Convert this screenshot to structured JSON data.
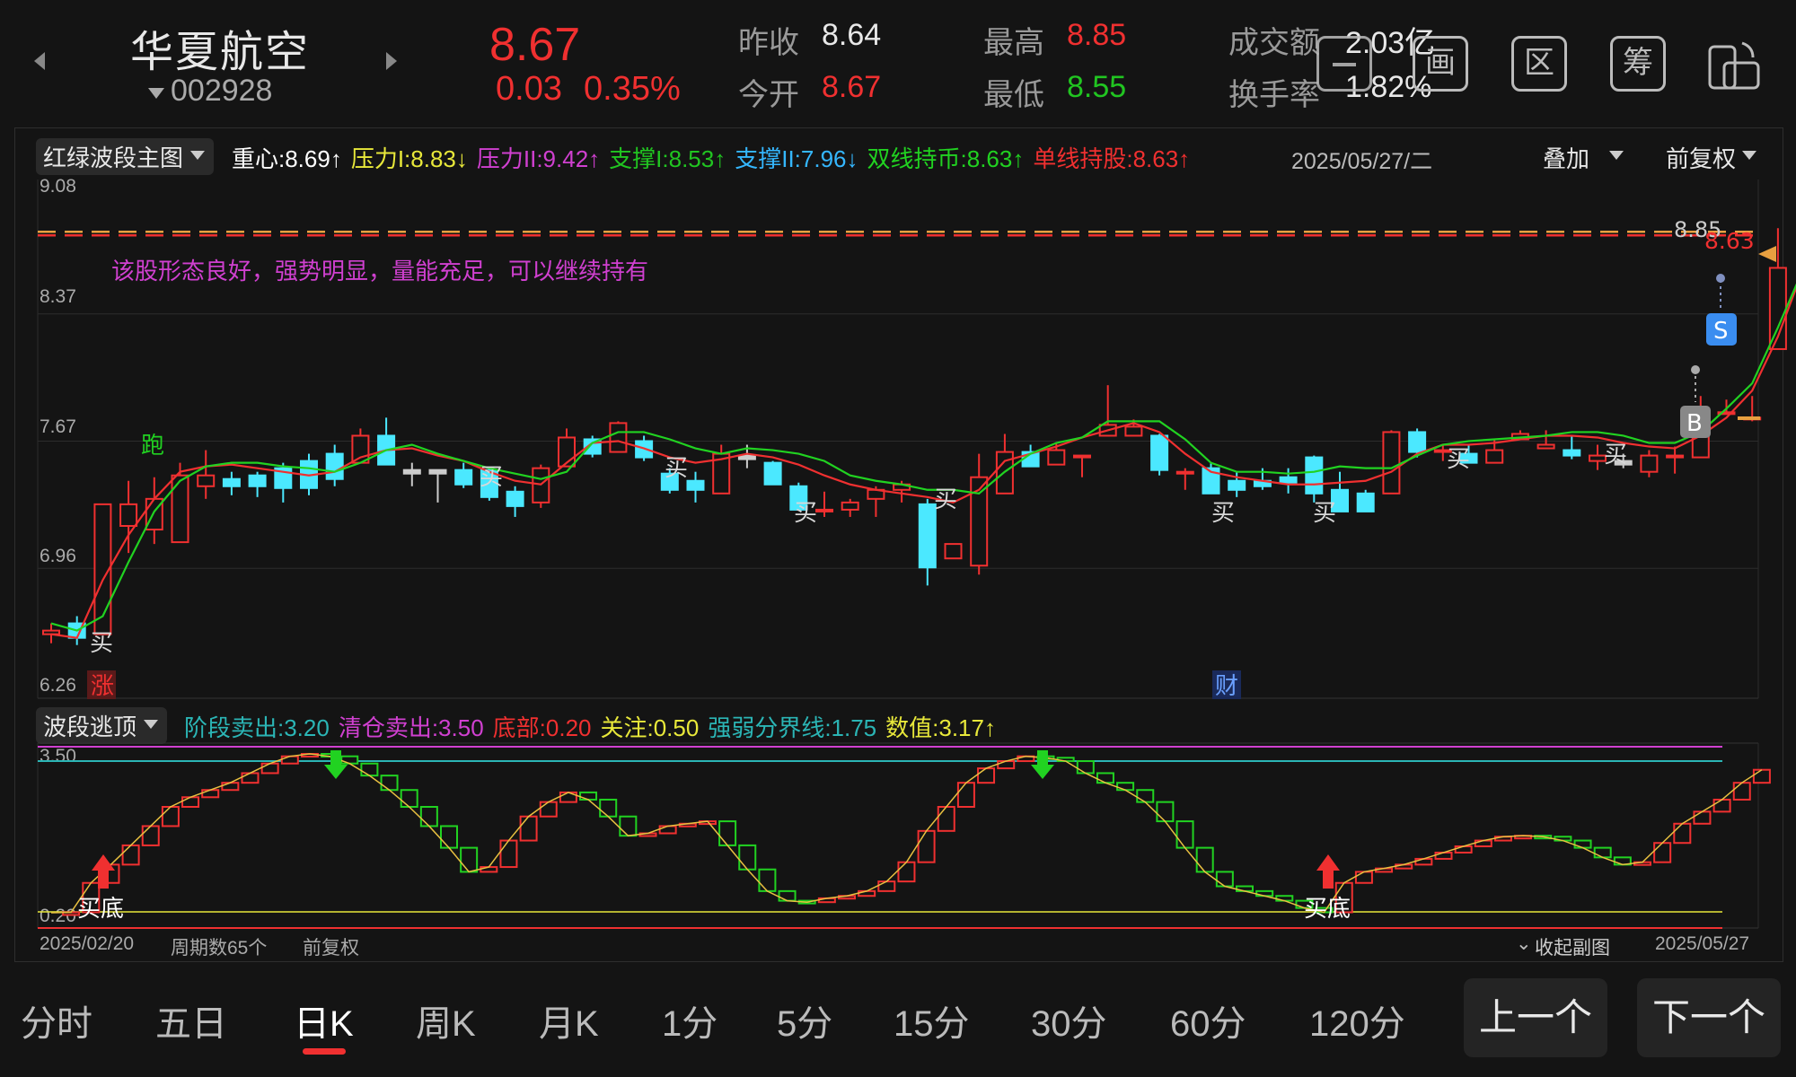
{
  "stock": {
    "name": "华夏航空",
    "code": "002928",
    "price": "8.67",
    "change": "0.03",
    "change_pct": "0.35%"
  },
  "quote": {
    "prev_close_label": "昨收",
    "prev_close": "8.64",
    "open_label": "今开",
    "open": "8.67",
    "high_label": "最高",
    "high": "8.85",
    "low_label": "最低",
    "low": "8.55",
    "turnover_label": "成交额",
    "turnover": "2.03亿",
    "rate_label": "换手率",
    "rate": "1.82%"
  },
  "tools": [
    "画",
    "区",
    "筹"
  ],
  "main_chart": {
    "selector": "红绿波段主图",
    "indicators": [
      {
        "text": "重心:8.69↑",
        "color": "#ffffff"
      },
      {
        "text": "压力I:8.83↓",
        "color": "#e8e83a"
      },
      {
        "text": "压力II:9.42↑",
        "color": "#d040d0"
      },
      {
        "text": "支撑I:8.53↑",
        "color": "#21c521"
      },
      {
        "text": "支撑II:7.96↓",
        "color": "#35b7ff"
      },
      {
        "text": "双线持币:8.63↑",
        "color": "#21d221"
      },
      {
        "text": "单线持股:8.63↑",
        "color": "#f03030"
      }
    ],
    "date": "2025/05/27/二",
    "overlay": "叠加",
    "adjust": "前复权",
    "message": "该股形态良好，强势明显，量能充足，可以继续持有",
    "yticks": [
      "9.08",
      "8.37",
      "7.67",
      "6.96",
      "6.26"
    ],
    "high_label": "8.85",
    "last_label": "8.63",
    "sig_run": "跑",
    "sig_up": "涨",
    "sig_cai": "财",
    "sig_buy": "买",
    "sig_S": "S",
    "sig_B": "B"
  },
  "chart_data": [
    {
      "type": "candlestick",
      "title": "红绿波段主图",
      "ylim": [
        6.26,
        9.08
      ],
      "dates": [
        "2025/02/20",
        "2025/05/27"
      ],
      "candles": [
        [
          6.6,
          6.62,
          6.55,
          6.66
        ],
        [
          6.66,
          6.58,
          6.54,
          6.7
        ],
        [
          6.6,
          7.32,
          6.6,
          7.32
        ],
        [
          7.2,
          7.32,
          7.05,
          7.45
        ],
        [
          7.18,
          7.35,
          7.1,
          7.47
        ],
        [
          7.11,
          7.48,
          7.11,
          7.55
        ],
        [
          7.42,
          7.48,
          7.35,
          7.62
        ],
        [
          7.46,
          7.42,
          7.37,
          7.5
        ],
        [
          7.48,
          7.42,
          7.36,
          7.5
        ],
        [
          7.52,
          7.41,
          7.33,
          7.55
        ],
        [
          7.56,
          7.41,
          7.37,
          7.6
        ],
        [
          7.6,
          7.46,
          7.42,
          7.65
        ],
        [
          7.55,
          7.7,
          7.55,
          7.74
        ],
        [
          7.7,
          7.54,
          7.54,
          7.8
        ],
        [
          7.51,
          7.49,
          7.42,
          7.55
        ],
        [
          7.51,
          7.49,
          7.33,
          7.5
        ],
        [
          7.51,
          7.43,
          7.41,
          7.55
        ],
        [
          7.51,
          7.36,
          7.34,
          7.52
        ],
        [
          7.39,
          7.31,
          7.25,
          7.42
        ],
        [
          7.33,
          7.52,
          7.3,
          7.54
        ],
        [
          7.53,
          7.69,
          7.53,
          7.74
        ],
        [
          7.68,
          7.6,
          7.58,
          7.7
        ],
        [
          7.61,
          7.77,
          7.61,
          7.78
        ],
        [
          7.67,
          7.58,
          7.56,
          7.7
        ],
        [
          7.49,
          7.4,
          7.38,
          7.52
        ],
        [
          7.45,
          7.4,
          7.33,
          7.5
        ],
        [
          7.38,
          7.6,
          7.38,
          7.65
        ],
        [
          7.59,
          7.57,
          7.52,
          7.65
        ],
        [
          7.55,
          7.43,
          7.43,
          7.56
        ],
        [
          7.42,
          7.29,
          7.29,
          7.44
        ],
        [
          7.29,
          7.29,
          7.25,
          7.39
        ],
        [
          7.29,
          7.33,
          7.25,
          7.35
        ],
        [
          7.35,
          7.4,
          7.25,
          7.42
        ],
        [
          7.4,
          7.43,
          7.33,
          7.45
        ],
        [
          7.32,
          6.97,
          6.87,
          7.35
        ],
        [
          7.02,
          7.1,
          7.04,
          7.1
        ],
        [
          6.98,
          7.47,
          6.93,
          7.6
        ],
        [
          7.38,
          7.61,
          7.38,
          7.71
        ],
        [
          7.61,
          7.53,
          7.53,
          7.65
        ],
        [
          7.54,
          7.62,
          7.54,
          7.66
        ],
        [
          7.59,
          7.59,
          7.47,
          7.59
        ],
        [
          7.7,
          7.76,
          7.7,
          7.98
        ],
        [
          7.7,
          7.75,
          7.7,
          7.79
        ],
        [
          7.7,
          7.51,
          7.48,
          7.71
        ],
        [
          7.49,
          7.5,
          7.4,
          7.52
        ],
        [
          7.52,
          7.38,
          7.38,
          7.55
        ],
        [
          7.45,
          7.4,
          7.36,
          7.5
        ],
        [
          7.45,
          7.42,
          7.4,
          7.52
        ],
        [
          7.47,
          7.44,
          7.38,
          7.52
        ],
        [
          7.58,
          7.38,
          7.33,
          7.59
        ],
        [
          7.4,
          7.28,
          7.28,
          7.5
        ],
        [
          7.38,
          7.28,
          7.28,
          7.4
        ],
        [
          7.38,
          7.72,
          7.38,
          7.73
        ],
        [
          7.72,
          7.61,
          7.58,
          7.74
        ],
        [
          7.62,
          7.62,
          7.56,
          7.65
        ],
        [
          7.6,
          7.55,
          7.55,
          7.65
        ],
        [
          7.55,
          7.62,
          7.55,
          7.68
        ],
        [
          7.68,
          7.71,
          7.68,
          7.73
        ],
        [
          7.63,
          7.65,
          7.63,
          7.73
        ],
        [
          7.62,
          7.59,
          7.57,
          7.7
        ],
        [
          7.56,
          7.59,
          7.51,
          7.65
        ],
        [
          7.56,
          7.54,
          7.52,
          7.6
        ],
        [
          7.5,
          7.59,
          7.47,
          7.62
        ],
        [
          7.58,
          7.59,
          7.49,
          7.64
        ],
        [
          7.58,
          7.83,
          7.58,
          7.92
        ],
        [
          7.83,
          7.83,
          7.83,
          7.9
        ],
        [
          7.8,
          7.8,
          7.78,
          7.92
        ],
        [
          8.18,
          8.63,
          8.18,
          8.85
        ]
      ],
      "series": [
        {
          "name": "单线持股",
          "color": "#f03030",
          "values": [
            6.6,
            6.58,
            6.9,
            7.15,
            7.35,
            7.5,
            7.53,
            7.54,
            7.52,
            7.5,
            7.48,
            7.5,
            7.58,
            7.62,
            7.63,
            7.59,
            7.56,
            7.5,
            7.45,
            7.43,
            7.55,
            7.66,
            7.67,
            7.63,
            7.58,
            7.55,
            7.57,
            7.6,
            7.58,
            7.54,
            7.48,
            7.43,
            7.4,
            7.38,
            7.36,
            7.33,
            7.4,
            7.56,
            7.6,
            7.64,
            7.69,
            7.73,
            7.77,
            7.72,
            7.6,
            7.5,
            7.47,
            7.45,
            7.43,
            7.43,
            7.44,
            7.45,
            7.5,
            7.6,
            7.65,
            7.65,
            7.66,
            7.68,
            7.7,
            7.7,
            7.69,
            7.66,
            7.64,
            7.63,
            7.7,
            7.8,
            7.95,
            8.25,
            8.63
          ]
        },
        {
          "name": "双线持币",
          "color": "#21d221",
          "values": [
            6.66,
            6.62,
            6.7,
            7.0,
            7.28,
            7.45,
            7.53,
            7.55,
            7.55,
            7.53,
            7.52,
            7.5,
            7.55,
            7.62,
            7.65,
            7.6,
            7.56,
            7.52,
            7.49,
            7.46,
            7.5,
            7.66,
            7.72,
            7.72,
            7.68,
            7.63,
            7.6,
            7.63,
            7.62,
            7.6,
            7.56,
            7.48,
            7.45,
            7.43,
            7.4,
            7.4,
            7.38,
            7.5,
            7.6,
            7.66,
            7.69,
            7.78,
            7.78,
            7.78,
            7.68,
            7.55,
            7.5,
            7.5,
            7.49,
            7.5,
            7.53,
            7.52,
            7.52,
            7.59,
            7.65,
            7.67,
            7.68,
            7.69,
            7.7,
            7.72,
            7.72,
            7.7,
            7.66,
            7.66,
            7.72,
            7.85,
            7.99,
            8.3,
            8.63
          ]
        }
      ]
    },
    {
      "type": "bar",
      "title": "波段逃顶",
      "ylim": [
        0.2,
        3.5
      ],
      "series": [
        {
          "name": "数值",
          "values": [
            0.2,
            0.21,
            0.82,
            1.2,
            1.6,
            2.0,
            2.4,
            2.6,
            2.75,
            2.9,
            3.1,
            3.3,
            3.45,
            3.5,
            3.45,
            3.3,
            3.05,
            2.75,
            2.4,
            2.0,
            1.55,
            1.05,
            1.15,
            1.7,
            2.2,
            2.5,
            2.7,
            2.55,
            2.2,
            1.8,
            1.85,
            2.0,
            2.05,
            2.1,
            1.6,
            1.1,
            0.65,
            0.45,
            0.42,
            0.5,
            0.55,
            0.65,
            0.85,
            1.25,
            1.9,
            2.4,
            2.9,
            3.2,
            3.35,
            3.45,
            3.42,
            3.35,
            3.1,
            2.9,
            2.75,
            2.5,
            2.1,
            1.55,
            1.05,
            0.75,
            0.65,
            0.55,
            0.45,
            0.3,
            0.21,
            0.82,
            1.05,
            1.12,
            1.2,
            1.32,
            1.45,
            1.58,
            1.7,
            1.78,
            1.8,
            1.78,
            1.7,
            1.55,
            1.35,
            1.2,
            1.25,
            1.65,
            2.05,
            2.3,
            2.55,
            2.9,
            3.17
          ]
        }
      ],
      "levels": [
        {
          "name": "阶段卖出",
          "value": 3.2,
          "color": "#2bb5b5"
        },
        {
          "name": "清仓卖出",
          "value": 3.5,
          "color": "#d040d0"
        },
        {
          "name": "底部",
          "value": 0.2,
          "color": "#f03030"
        },
        {
          "name": "关注",
          "value": 0.5,
          "color": "#e8e83a"
        },
        {
          "name": "强弱分界线",
          "value": 1.75,
          "color": "#2bb5b5"
        }
      ]
    }
  ],
  "sub_chart": {
    "selector": "波段逃顶",
    "indicators": [
      {
        "text": "阶段卖出:3.20",
        "color": "#2bb5b5"
      },
      {
        "text": "清仓卖出:3.50",
        "color": "#d040d0"
      },
      {
        "text": "底部:0.20",
        "color": "#f03030"
      },
      {
        "text": "关注:0.50",
        "color": "#e8e83a"
      },
      {
        "text": "强弱分界线:1.75",
        "color": "#2bb5b5"
      },
      {
        "text": "数值:3.17↑",
        "color": "#e8e83a"
      }
    ],
    "ytick_top": "3.50",
    "ytick_bottom": "0.20",
    "buy_bottom": "买底"
  },
  "footer": {
    "start_date": "2025/02/20",
    "periods": "周期数65个",
    "adjust": "前复权",
    "collapse": "收起副图",
    "end_date": "2025/05/27"
  },
  "tabs": [
    "分时",
    "五日",
    "日K",
    "周K",
    "月K",
    "1分",
    "5分",
    "15分",
    "30分",
    "60分",
    "120分"
  ],
  "active_tab": "日K",
  "nav": {
    "prev": "上一个",
    "next": "下一个"
  }
}
